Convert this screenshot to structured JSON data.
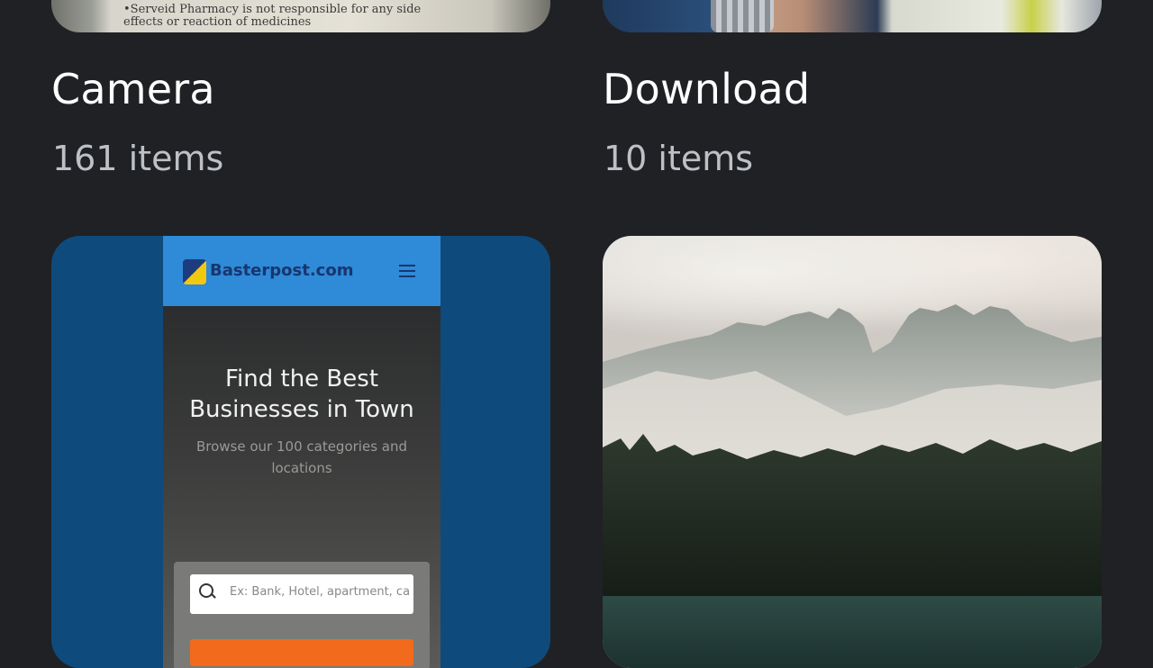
{
  "albums": [
    {
      "title": "Camera",
      "count": "161 items",
      "thumb_text": [
        "•Serveid Pharmacy is not responsible for any side",
        "effects or reaction of medicines"
      ]
    },
    {
      "title": "Download",
      "count": "10 items"
    }
  ],
  "screenshot_album_thumb": {
    "site_name": "Basterpost.com",
    "headline": "Find the Best Businesses in Town",
    "subtext": "Browse our 100 categories and locations",
    "search_placeholder": "Ex: Bank, Hotel, apartment, ca"
  },
  "colors": {
    "background": "#202124",
    "title_text": "#ffffff",
    "count_text": "#bdc1c6"
  }
}
